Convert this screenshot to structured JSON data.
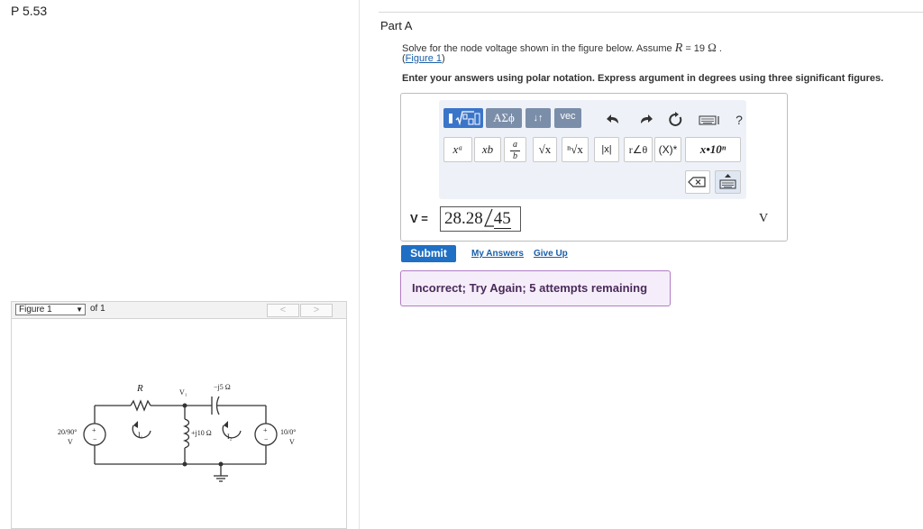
{
  "problem": {
    "id": "P 5.53"
  },
  "part": {
    "title": "Part A"
  },
  "question": {
    "text_before": "Solve for the node voltage shown in the figure below. Assume ",
    "variable": "R",
    "text_equals": " = 19 ",
    "unit": "Ω",
    "text_end": " .",
    "figure_link_open": "(",
    "figure_link": "Figure 1",
    "figure_link_close": ")",
    "instruction": "Enter your answers using polar notation. Express argument in degrees using three significant figures."
  },
  "toolbar": {
    "templates_icon": "template-fraction-sqrt-icon",
    "greek": "ΑΣϕ",
    "arrows": "↓↑",
    "vec": "vec",
    "undo_icon": "undo-icon",
    "redo_icon": "redo-icon",
    "reset_icon": "reset-icon",
    "keyboard_icon": "keyboard-icon",
    "help": "?",
    "math_buttons": {
      "power": "xᵃ",
      "subscript": "xb",
      "fraction_num": "a",
      "fraction_den": "b",
      "sqrt": "√x",
      "nthroot": "ⁿ√x",
      "abs": "|x|",
      "polar": "r∠θ",
      "conjugate": "(X)*",
      "sci": "x•10ⁿ"
    },
    "backspace_icon": "backspace-icon",
    "show_keyboard_icon": "show-keyboard-icon"
  },
  "answer": {
    "label": "V =",
    "magnitude": "28.28",
    "angle": "45",
    "unit": "V"
  },
  "actions": {
    "submit": "Submit",
    "my_answers": "My Answers",
    "give_up": "Give Up"
  },
  "feedback": {
    "text": "Incorrect; Try Again; 5 attempts remaining"
  },
  "figure_nav": {
    "selected": "Figure 1",
    "of_label": "of 1",
    "prev": "<",
    "next": ">"
  },
  "circuit": {
    "r_label": "R",
    "v1_label": "V₁",
    "cap_label": "−j5 Ω",
    "ind_label": "+j10 Ω",
    "i1_label": "I₁",
    "i2_label": "I₂",
    "src_left_value": "20/90°",
    "src_left_unit": "V",
    "src_right_value": "10/0°",
    "src_right_unit": "V"
  }
}
